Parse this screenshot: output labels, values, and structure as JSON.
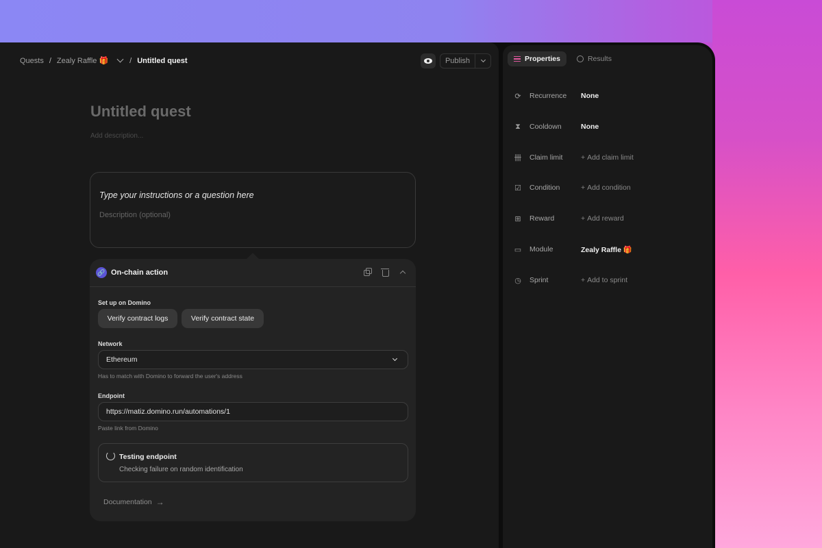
{
  "breadcrumb": {
    "root": "Quests",
    "module": "Zealy Raffle 🎁",
    "current": "Untitled quest"
  },
  "toolbar": {
    "preview_icon": "eye-icon",
    "publish_label": "Publish"
  },
  "quest": {
    "title": "Untitled quest",
    "description_placeholder": "Add description..."
  },
  "instruction": {
    "question_placeholder": "Type your instructions or a question here",
    "description_placeholder": "Description (optional)"
  },
  "action": {
    "title": "On-chain action",
    "setup_label": "Set up on Domino",
    "setup_options": [
      "Verify contract logs",
      "Verify contract state"
    ],
    "network_label": "Network",
    "network_value": "Ethereum",
    "network_hint": "Has to match with Domino to forward the user's address",
    "endpoint_label": "Endpoint",
    "endpoint_value": "https://matiz.domino.run/automations/1",
    "endpoint_hint": "Paste link from Domino",
    "testing_title": "Testing endpoint",
    "testing_status": "Checking failure on random identification",
    "documentation_label": "Documentation"
  },
  "side": {
    "tabs": [
      {
        "label": "Properties",
        "active": true,
        "icon": "list-icon"
      },
      {
        "label": "Results",
        "active": false,
        "icon": "pie-chart-icon"
      }
    ],
    "properties": [
      {
        "name": "Recurrence",
        "value": "None",
        "icon": "refresh-icon"
      },
      {
        "name": "Cooldown",
        "value": "None",
        "icon": "hourglass-icon"
      },
      {
        "name": "Claim limit",
        "value": "Add claim limit",
        "icon": "tally-icon"
      },
      {
        "name": "Condition",
        "value": "Add condition",
        "icon": "check-square-icon"
      },
      {
        "name": "Reward",
        "value": "Add reward",
        "icon": "gift-icon"
      },
      {
        "name": "Module",
        "value": "Zealy Raffle 🎁",
        "icon": "folder-icon"
      },
      {
        "name": "Sprint",
        "value": "Add to sprint",
        "icon": "timer-icon"
      }
    ]
  },
  "colors": {
    "accent_pink": "#e0579e",
    "link_purple": "#5b54d6",
    "panel_bg": "#191919",
    "card_bg": "#232323"
  }
}
